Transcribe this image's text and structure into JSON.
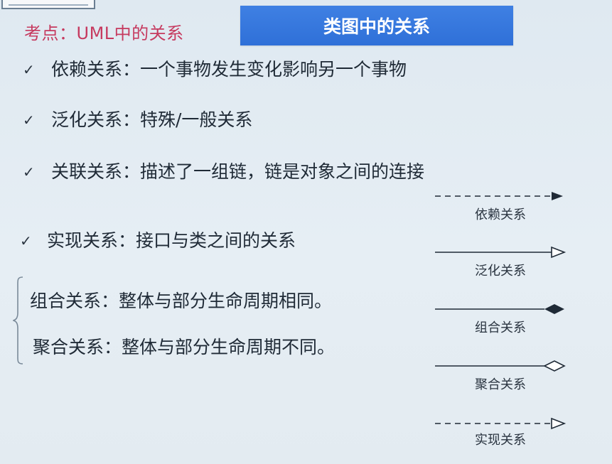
{
  "header": {
    "kaodian_label": "考点：UML中的关系",
    "title": "类图中的关系"
  },
  "bullets": [
    {
      "check": "✓",
      "text": "依赖关系：一个事物发生变化影响另一个事物"
    },
    {
      "check": "✓",
      "text": "泛化关系：特殊/一般关系"
    },
    {
      "check": "✓",
      "text": "关联关系：描述了一组链，链是对象之间的连接"
    },
    {
      "check": "✓",
      "text": "实现关系：接口与类之间的关系"
    }
  ],
  "group": {
    "items": [
      {
        "text": "组合关系：整体与部分生命周期相同。"
      },
      {
        "text": "聚合关系：整体与部分生命周期不同。"
      }
    ]
  },
  "legend": {
    "items": [
      {
        "label": "依赖关系",
        "line": "dashed",
        "head": "filled-triangle",
        "icon": "dependency-arrow-icon"
      },
      {
        "label": "泛化关系",
        "line": "solid",
        "head": "hollow-triangle",
        "icon": "generalization-arrow-icon"
      },
      {
        "label": "组合关系",
        "line": "solid",
        "head": "filled-diamond",
        "icon": "composition-arrow-icon"
      },
      {
        "label": "聚合关系",
        "line": "solid",
        "head": "hollow-diamond",
        "icon": "aggregation-arrow-icon"
      },
      {
        "label": "实现关系",
        "line": "dashed",
        "head": "hollow-triangle",
        "icon": "realization-arrow-icon"
      }
    ]
  },
  "colors": {
    "kaodian": "#c63a5f",
    "banner": "#2f70d8",
    "line": "#1f2a36"
  }
}
